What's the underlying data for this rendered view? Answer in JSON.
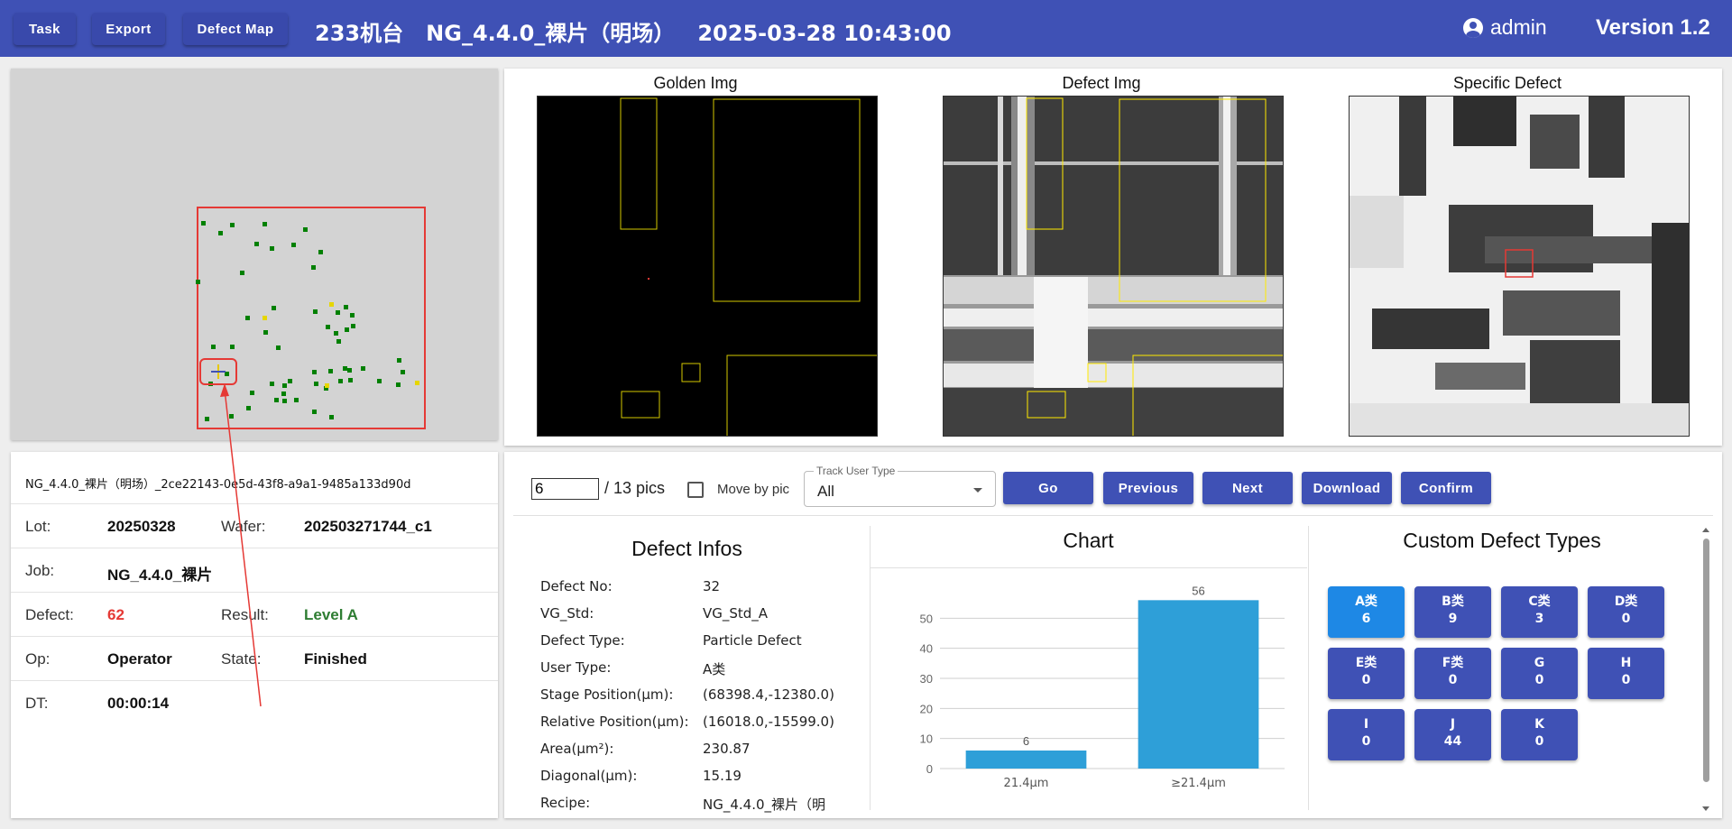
{
  "topbar": {
    "buttons": [
      "Task",
      "Export",
      "Defect Map"
    ],
    "title": "233机台   NG_4.4.0_裸片（明场）   2025-03-28 10:43:00",
    "user": "admin",
    "version": "Version 1.2",
    "user_icon": "account-circle-icon"
  },
  "images": {
    "golden_title": "Golden Img",
    "defect_title": "Defect Img",
    "specific_title": "Specific Defect"
  },
  "info": {
    "id": "NG_4.4.0_裸片（明场）_2ce22143-0e5d-43f8-a9a1-9485a133d90d",
    "lot_label": "Lot:",
    "lot": "20250328",
    "wafer_label": "Wafer:",
    "wafer": "202503271744_c1",
    "job_label": "Job:",
    "job": "NG_4.4.0_裸片",
    "defect_label": "Defect:",
    "defect": "62",
    "result_label": "Result:",
    "result": "Level A",
    "op_label": "Op:",
    "op": "Operator",
    "state_label": "State:",
    "state": "Finished",
    "dt_label": "DT:",
    "dt": "00:00:14"
  },
  "controls": {
    "pic_value": "6",
    "pics_label": "/ 13 pics",
    "move_by_pic": "Move by pic",
    "track_legend": "Track User Type",
    "track_value": "All",
    "buttons": [
      "Go",
      "Previous",
      "Next",
      "Download",
      "Confirm"
    ]
  },
  "defect_infos": {
    "title": "Defect Infos",
    "rows": [
      {
        "k": "Defect No:",
        "v": "32"
      },
      {
        "k": "VG_Std:",
        "v": "VG_Std_A"
      },
      {
        "k": "Defect Type:",
        "v": "Particle Defect"
      },
      {
        "k": "User Type:",
        "v": "A类"
      },
      {
        "k": "Stage Position(μm):",
        "v": "(68398.4,-12380.0)"
      },
      {
        "k": "Relative Position(μm):",
        "v": "(16018.0,-15599.0)"
      },
      {
        "k": "Area(μm²):",
        "v": "230.87"
      },
      {
        "k": "Diagonal(μm):",
        "v": "15.19"
      },
      {
        "k": "Recipe:",
        "v": "NG_4.4.0_裸片（明"
      }
    ]
  },
  "chart_data": {
    "type": "bar",
    "title": "Chart",
    "categories": [
      "21.4μm",
      "≥21.4μm"
    ],
    "values": [
      6,
      56
    ],
    "ylim": [
      0,
      60
    ],
    "yticks": [
      0,
      10,
      20,
      30,
      40,
      50
    ],
    "color": "#2e9fd8",
    "grid": true
  },
  "custom_types": {
    "title": "Custom Defect Types",
    "items": [
      {
        "name": "A类",
        "count": "6",
        "active": true
      },
      {
        "name": "B类",
        "count": "9"
      },
      {
        "name": "C类",
        "count": "3"
      },
      {
        "name": "D类",
        "count": "0"
      },
      {
        "name": "E类",
        "count": "0"
      },
      {
        "name": "F类",
        "count": "0"
      },
      {
        "name": "G",
        "count": "0"
      },
      {
        "name": "H",
        "count": "0"
      },
      {
        "name": "I",
        "count": "0"
      },
      {
        "name": "J",
        "count": "44"
      },
      {
        "name": "K",
        "count": "0"
      }
    ]
  },
  "colors": {
    "primary": "#3f51b5",
    "active": "#1e88e5",
    "defect_red": "#e53935",
    "level_green": "#2e7d32",
    "map_point": "#008000",
    "map_highlight": "#e6d600"
  }
}
